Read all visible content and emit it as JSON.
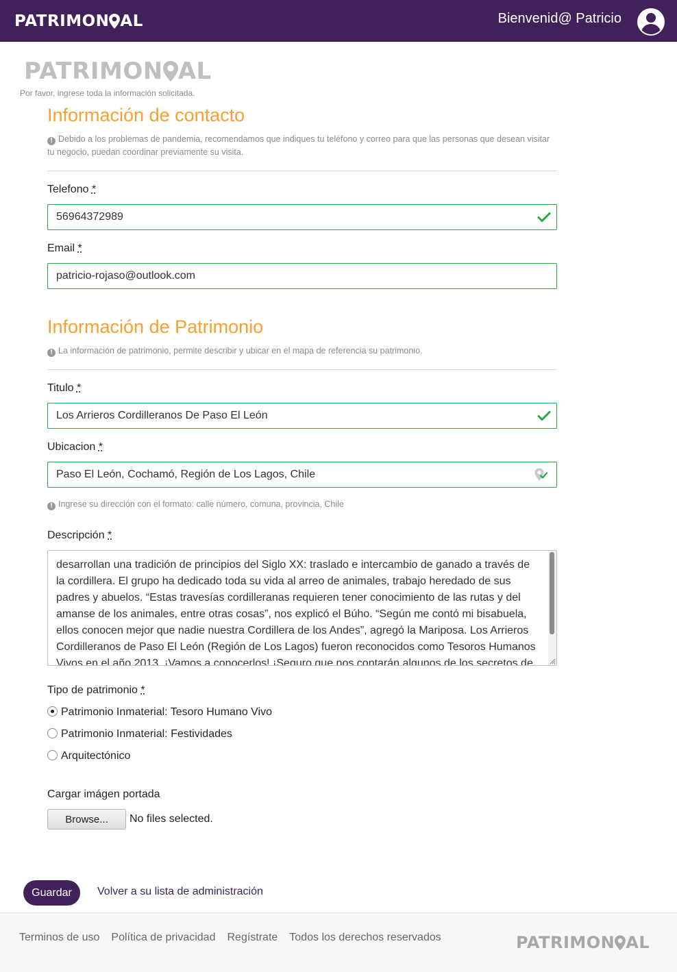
{
  "brand": {
    "name_start": "PATRIMON",
    "name_end": "AL",
    "accent": "#40215a",
    "section_color": "#f5a031"
  },
  "navbar": {
    "welcome": "Bienvenid@ Patricio",
    "user_icon": "user-circle-icon"
  },
  "intro": "Por favor, ingrese toda la información solicitada.",
  "contact": {
    "title": "Información de contacto",
    "hint": "Debido a los problemas de pandemia, recomendamos que indiques tu teléfono y correo para que las personas que desean visitar tu negocio, puedan coordinar previamente su visita.",
    "phone_label": "Telefono",
    "phone_value": "56964372989",
    "email_label": "Email",
    "email_value": "patricio-rojaso@outlook.com"
  },
  "heritage": {
    "title": "Información de Patrimonio",
    "hint": "La información de patrimonio, permite describir y ubicar en el mapa de referencia su patrimonio.",
    "title_label": "Titulo",
    "title_value": "Los Arrieros Cordilleranos De Paso El León",
    "location_label": "Ubicacion",
    "location_value": "Paso El León, Cochamó, Región de Los Lagos, Chile",
    "location_hint": "Ingrese su dirección con el formato: calle número, comuna, provincia, Chile",
    "description_label": "Descripción",
    "description_value": "desarrollan una tradición de principios del Siglo XX: traslado e intercambio de ganado a través de la cordillera. El grupo ha dedicado toda su vida al arreo de animales, trabajo heredado de sus padres y abuelos. “Estas travesías cordilleranas requieren tener conocimiento de las rutas y del amanse de los animales, entre otras cosas”, nos explicó el Búho. “Según me contó mi bisabuela, ellos conocen mejor que nadie nuestra Cordillera de los Andes”, agregó la Mariposa. Los Arrieros Cordilleranos de Paso El León (Región de Los Lagos) fueron reconocidos como Tesoros Humanos Vivos en el año 2013. ¡Vamos a conocerlos! ¡Seguro que nos contarán algunos de los secretos de la Cordillera de",
    "type_label": "Tipo de patrimonio",
    "type_options": [
      {
        "label": "Patrimonio Inmaterial: Tesoro Humano Vivo",
        "checked": true
      },
      {
        "label": "Patrimonio Inmaterial: Festividades",
        "checked": false
      },
      {
        "label": "Arquitectónico",
        "checked": false
      }
    ],
    "cover_label": "Cargar imágen portada",
    "browse_label": "Browse...",
    "file_status": "No files selected."
  },
  "required_mark": "*",
  "actions": {
    "save": "Guardar",
    "back": "Volver a su lista de administración"
  },
  "footer": {
    "links": [
      "Terminos de uso",
      "Política de privacidad",
      "Regístrate",
      "Todos los derechos reservados"
    ]
  },
  "icons": [
    "check-icon",
    "map-pin-icon",
    "info-icon"
  ]
}
